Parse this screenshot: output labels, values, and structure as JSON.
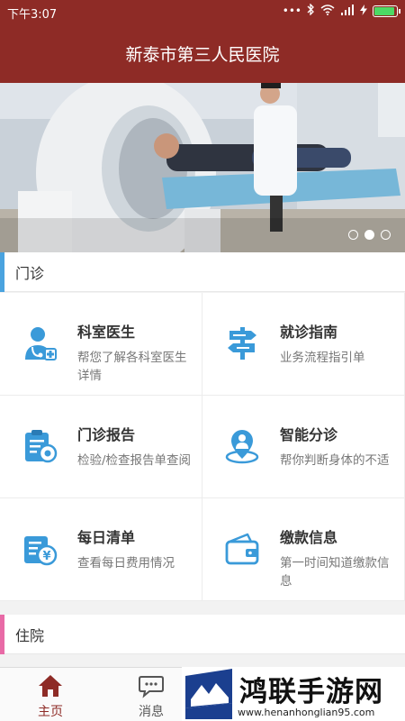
{
  "status_bar": {
    "time": "下午3:07",
    "battery_level": 1.0
  },
  "header": {
    "title": "新泰市第三人民医院"
  },
  "banner": {
    "slide_count": 3,
    "active_slide": 2
  },
  "sections": {
    "outpatient": {
      "title": "门诊",
      "accent": "#4aa3df"
    },
    "inpatient": {
      "title": "住院",
      "accent": "#e86aa6"
    }
  },
  "outpatient_items": [
    {
      "title": "科室医生",
      "desc": "帮您了解各科室医生详情",
      "icon": "doctor-icon"
    },
    {
      "title": "就诊指南",
      "desc": "业务流程指引单",
      "icon": "signpost-icon"
    },
    {
      "title": "门诊报告",
      "desc": "检验/检查报告单查阅",
      "icon": "report-clipboard-icon"
    },
    {
      "title": "智能分诊",
      "desc": "帮你判断身体的不适",
      "icon": "body-location-icon"
    },
    {
      "title": "每日清单",
      "desc": "查看每日费用情况",
      "icon": "daily-bill-icon"
    },
    {
      "title": "缴款信息",
      "desc": "第一时间知道缴款信息",
      "icon": "wallet-icon"
    }
  ],
  "tabbar": {
    "home_label": "主页",
    "messages_label": "消息",
    "active_color": "#8e2b26",
    "inactive_color": "#555555"
  },
  "watermark": {
    "title": "鸿联手游网",
    "url": "www.henanhonglian95.com"
  },
  "colors": {
    "brand": "#8e2b26",
    "icon_blue": "#3a9ad9"
  }
}
